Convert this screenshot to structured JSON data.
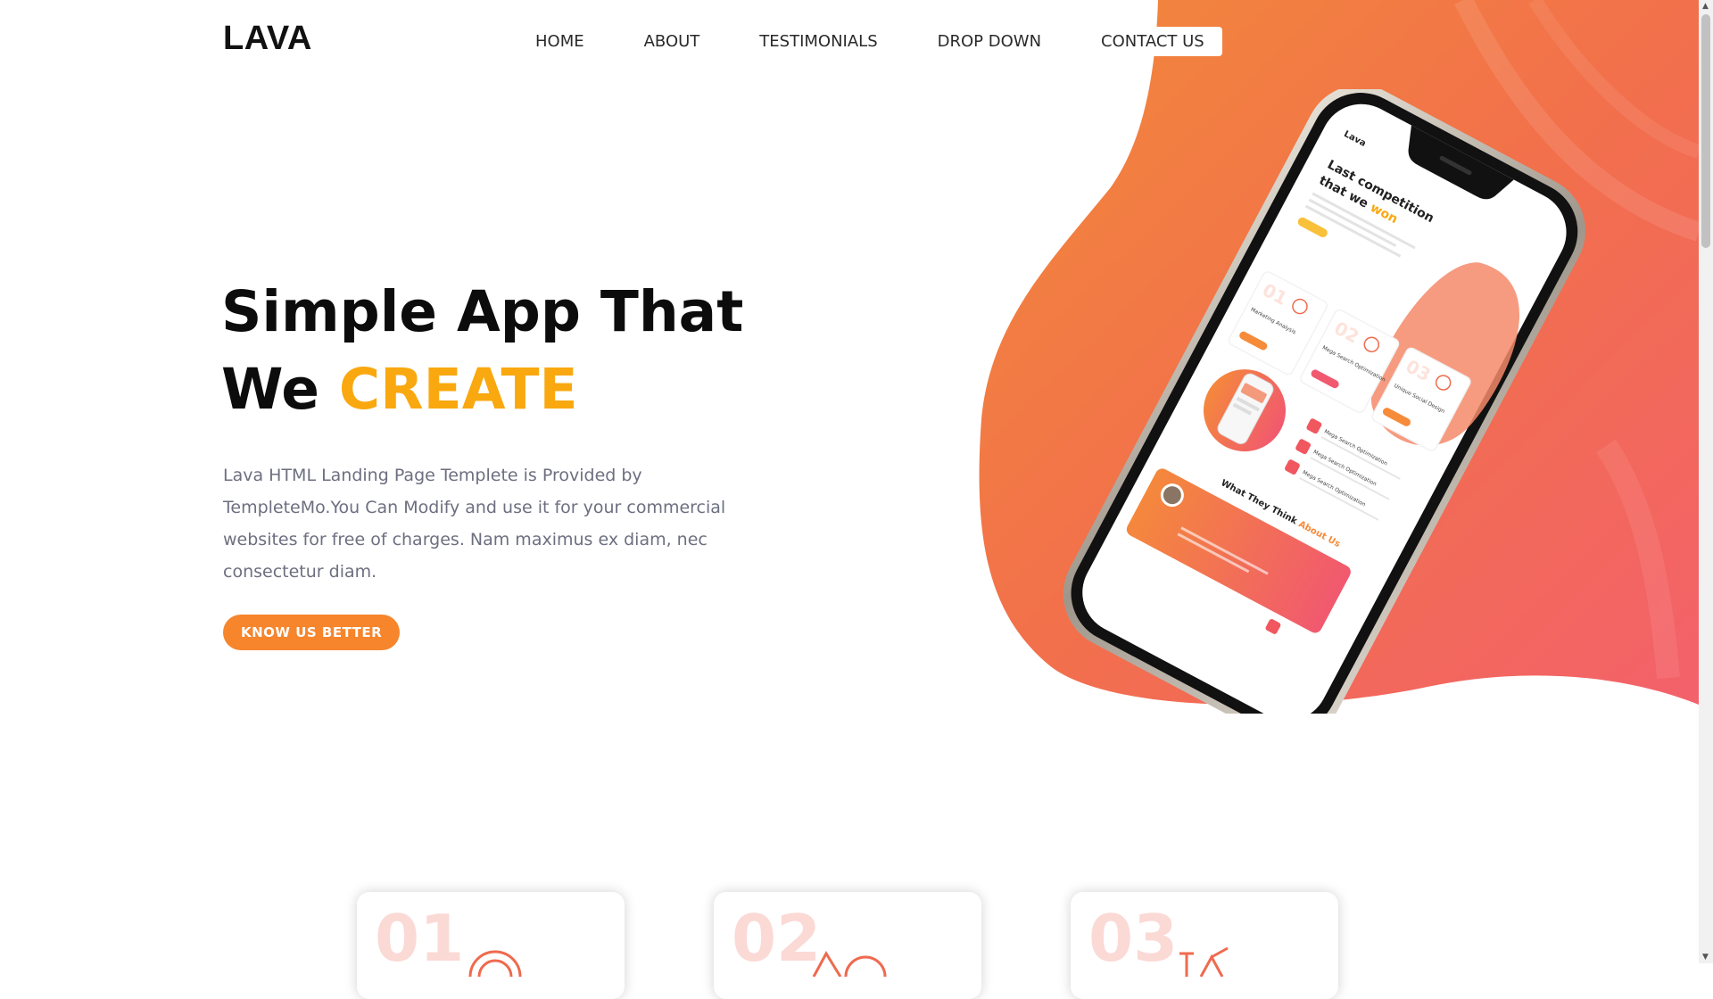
{
  "brand": {
    "logo": "LAVA"
  },
  "nav": {
    "items": [
      {
        "label": "HOME"
      },
      {
        "label": "ABOUT"
      },
      {
        "label": "TESTIMONIALS"
      },
      {
        "label": "DROP DOWN"
      },
      {
        "label": "CONTACT US"
      }
    ]
  },
  "hero": {
    "title_line1": "Simple App That",
    "title_line2_prefix": "We ",
    "title_line2_accent": "CREATE",
    "description": "Lava HTML Landing Page Templete is Provided by TempleteMo.You Can Modify and use it for your commercial websites for free of charges. Nam maximus ex diam, nec consectetur diam.",
    "button_label": "KNOW US BETTER"
  },
  "phone_screen": {
    "brand": "Lava",
    "headline_line1": "Last competition",
    "headline_line2": "that we ",
    "headline_accent": "won",
    "services": [
      "Marketing Analysis",
      "Mega Search Optimization",
      "Unique Social Design"
    ],
    "list_items": [
      "Mega Search Optimization",
      "Mega Search Optimization",
      "Mega Search Optimization"
    ],
    "testimonial_title": "What They Think ",
    "testimonial_accent": "About Us",
    "card_numbers": [
      "01",
      "02",
      "03"
    ]
  },
  "features": [
    {
      "number": "01",
      "icon": "target-icon"
    },
    {
      "number": "02",
      "icon": "shapes-icon"
    },
    {
      "number": "03",
      "icon": "design-icon"
    }
  ],
  "colors": {
    "accent": "#f9a80f",
    "button": "#f6852c",
    "gradient_start": "#f27a37",
    "gradient_end": "#f3616b",
    "text_muted": "#6d6f80"
  }
}
